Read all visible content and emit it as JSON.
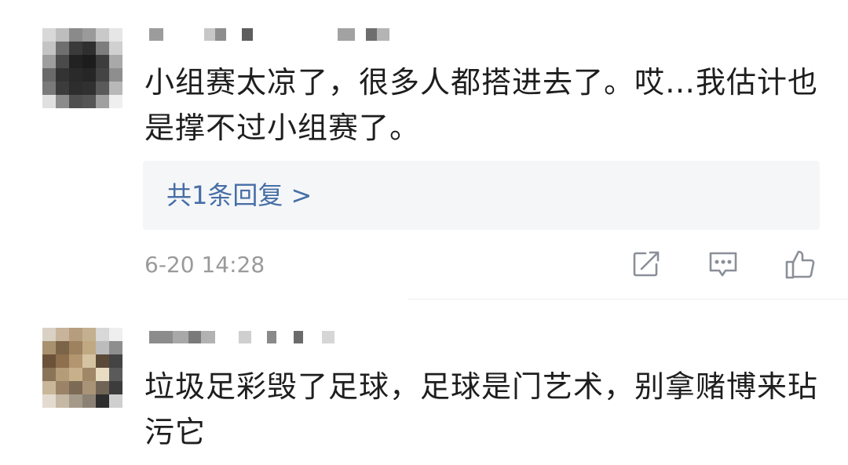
{
  "comments": [
    {
      "text": "小组赛太凉了，很多人都搭进去了。哎…我估计也是撑不过小组赛了。",
      "reply_link": "共1条回复 >",
      "timestamp": "6-20 14:28",
      "actions": [
        "share-icon",
        "comment-icon",
        "thumbs-up-icon"
      ]
    },
    {
      "text": "垃圾足彩毁了足球，足球是门艺术，别拿赌博来玷污它"
    }
  ],
  "colors": {
    "reply_link": "#466ea6",
    "timestamp": "#9a9a9a",
    "reply_box": "#f5f6f8",
    "icon": "#8a8f99"
  }
}
